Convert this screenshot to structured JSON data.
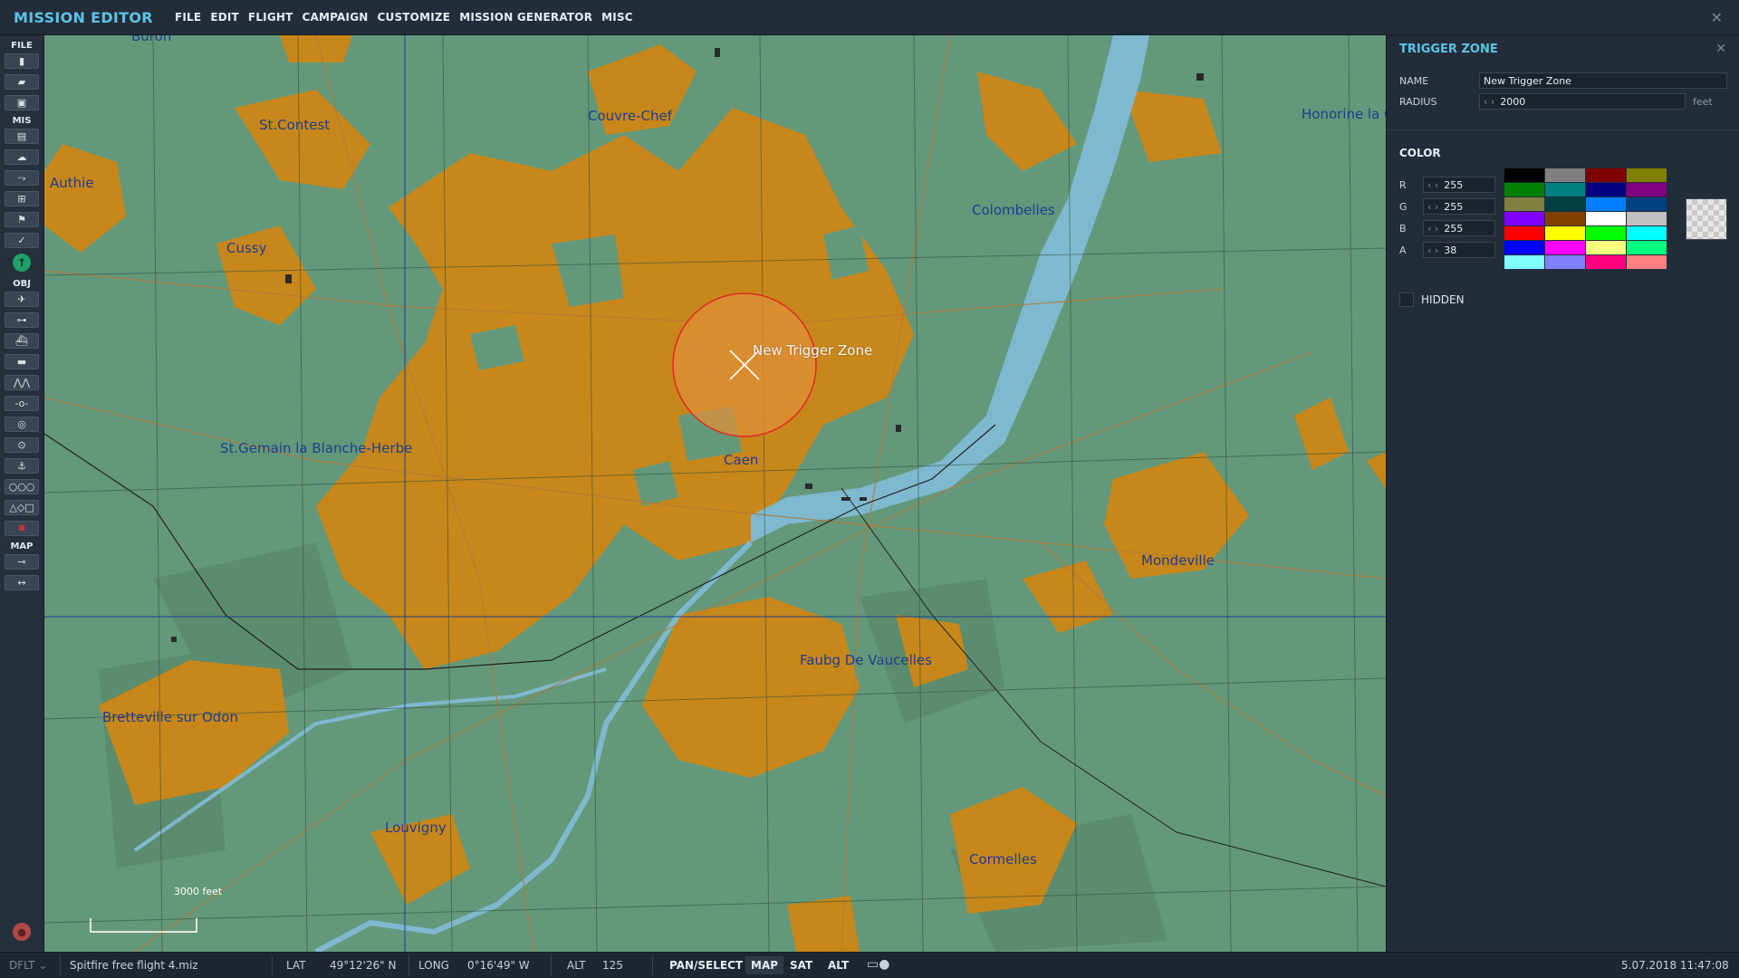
{
  "app": {
    "title": "MISSION EDITOR",
    "close_icon": "close-icon"
  },
  "menu": [
    "FILE",
    "EDIT",
    "FLIGHT",
    "CAMPAIGN",
    "CUSTOMIZE",
    "MISSION GENERATOR",
    "MISC"
  ],
  "toolbar": {
    "sections": {
      "file": "FILE",
      "mis": "MIS",
      "obj": "OBJ",
      "map": "MAP"
    },
    "file_icons": [
      "new-file-icon",
      "open-folder-icon",
      "save-icon"
    ],
    "mis_icons": [
      "mission-clipboard-icon",
      "weather-icon",
      "route-icon",
      "unit-icon",
      "flag-icon",
      "check-icon"
    ],
    "obj_icons": [
      "plane-icon",
      "helicopter-icon",
      "ship-icon",
      "vehicle-icon",
      "group-icon",
      "waypoint-icon",
      "target-icon",
      "static-icon",
      "anchor-icon",
      "chain-icon",
      "shapes-icon",
      "delete-icon"
    ],
    "map_icons": [
      "map-options-icon",
      "ruler-icon"
    ]
  },
  "map": {
    "places": [
      {
        "name": "St.Contest"
      },
      {
        "name": "Couvre-Chef"
      },
      {
        "name": "Honorine la C"
      },
      {
        "name": "Authie"
      },
      {
        "name": "Colombelles"
      },
      {
        "name": "Cussy"
      },
      {
        "name": "St.Gemain la Blanche-Herbe"
      },
      {
        "name": "Caen"
      },
      {
        "name": "Mondeville"
      },
      {
        "name": "Faubg De Vaucelles"
      },
      {
        "name": "Bretteville sur Odon"
      },
      {
        "name": "Louvigny"
      },
      {
        "name": "Cormelles"
      },
      {
        "name": "Buron"
      }
    ],
    "trigger_zone_label": "New Trigger Zone",
    "scale_label": "3000 feet",
    "colors": {
      "land": "#64987a",
      "urban": "#c8871a",
      "river": "#7eb9cf",
      "zone": "#e09036",
      "zone_edge": "#e02828"
    }
  },
  "panel": {
    "title": "TRIGGER ZONE",
    "name_label": "NAME",
    "name_value": "New Trigger Zone",
    "radius_label": "RADIUS",
    "radius_value": "2000",
    "radius_unit": "feet",
    "color_title": "COLOR",
    "channels": [
      {
        "label": "R",
        "value": "255"
      },
      {
        "label": "G",
        "value": "255"
      },
      {
        "label": "B",
        "value": "255"
      },
      {
        "label": "A",
        "value": "38"
      }
    ],
    "swatches": [
      "#000000",
      "#808080",
      "#800000",
      "#808000",
      "#008000",
      "#008080",
      "#000080",
      "#800080",
      "#808040",
      "#004040",
      "#0080ff",
      "#004080",
      "#8000ff",
      "#804000",
      "#ffffff",
      "#c0c0c0",
      "#ff0000",
      "#ffff00",
      "#00ff00",
      "#00ffff",
      "#0000ff",
      "#ff00ff",
      "#ffff80",
      "#00ff80",
      "#80ffff",
      "#8080ff",
      "#ff0080",
      "#ff8080"
    ],
    "hidden_label": "HIDDEN"
  },
  "status": {
    "mode": "DFLT",
    "file": "Spitfire free flight 4.miz",
    "lat_label": "LAT",
    "lat_value": "49°12'26\" N",
    "long_label": "LONG",
    "long_value": "0°16'49\" W",
    "alt_label": "ALT",
    "alt_value": "125",
    "pan_select": "PAN/SELECT",
    "map_btn": "MAP",
    "sat_btn": "SAT",
    "alt_btn": "ALT",
    "datetime": "5.07.2018 11:47:08"
  }
}
